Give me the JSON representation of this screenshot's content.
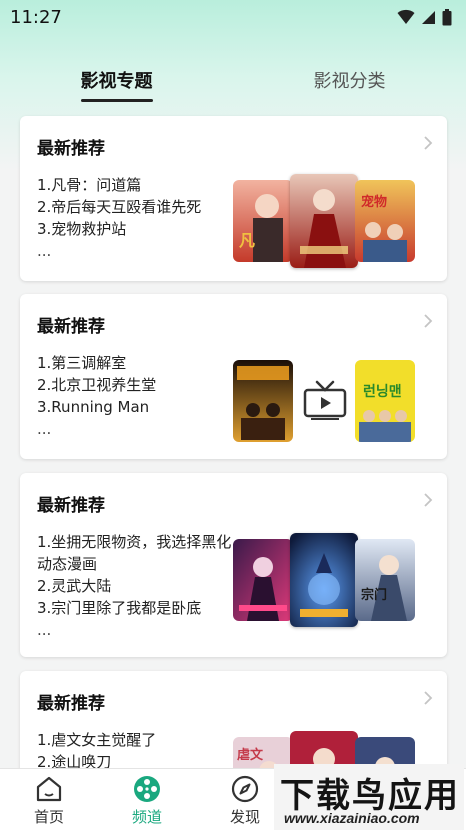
{
  "status_bar": {
    "time": "11:27"
  },
  "tabs": [
    {
      "label": "影视专题",
      "active": true
    },
    {
      "label": "影视分类",
      "active": false
    }
  ],
  "cards": [
    {
      "title": "最新推荐",
      "items": [
        "1.凡骨：问道篇",
        "2.帝后每天互殴看谁先死",
        "3.宠物救护站"
      ],
      "more": "...",
      "posters": [
        {
          "caption": "凡骨",
          "colors": [
            "#c43a2a",
            "#f2b3a0"
          ]
        },
        {
          "caption": "帝后每天互殴看谁先死",
          "colors": [
            "#9a1d16",
            "#e8c7b8"
          ]
        },
        {
          "caption": "宠物救护站",
          "colors": [
            "#c73a2e",
            "#f0c45a"
          ]
        }
      ]
    },
    {
      "title": "最新推荐",
      "items": [
        "1.第三调解室",
        "2.北京卫视养生堂",
        "3.Running Man"
      ],
      "more": "...",
      "posters": [
        {
          "caption": "第三调解室",
          "colors": [
            "#2a1a10",
            "#e0a030"
          ]
        },
        {
          "caption": "",
          "colors": [
            "#ffffff",
            "#ffffff"
          ]
        },
        {
          "caption": "런닝맨",
          "colors": [
            "#f2de2a",
            "#3a8a3a"
          ]
        }
      ]
    },
    {
      "title": "最新推荐",
      "items": [
        "1.坐拥无限物资，我选择黑化 动态漫画",
        "2.灵武大陆",
        "3.宗门里除了我都是卧底"
      ],
      "more": "...",
      "posters": [
        {
          "caption": "坐拥无限物资",
          "colors": [
            "#3a1a4a",
            "#e03a7a"
          ]
        },
        {
          "caption": "灵武大陆",
          "colors": [
            "#0e1a3a",
            "#2a6ad0"
          ]
        },
        {
          "caption": "宗门里除了我都是卧底",
          "colors": [
            "#c8d6e8",
            "#5a6a8a"
          ]
        }
      ]
    },
    {
      "title": "最新推荐",
      "items": [
        "1.虐文女主觉醒了",
        "2.途山唤刀"
      ],
      "more": "",
      "posters": [
        {
          "caption": "虐文女主觉醒了",
          "colors": [
            "#e8d0d8",
            "#c43a4a"
          ]
        },
        {
          "caption": "",
          "colors": [
            "#b0203a",
            "#e06a6a"
          ]
        },
        {
          "caption": "",
          "colors": [
            "#3a4a7a",
            "#d8c0a0"
          ]
        }
      ]
    }
  ],
  "bottom_nav": [
    {
      "label": "首页",
      "icon": "home-icon",
      "active": false
    },
    {
      "label": "频道",
      "icon": "film-reel-icon",
      "active": true
    },
    {
      "label": "发现",
      "icon": "compass-icon",
      "active": false
    },
    {
      "label": "",
      "icon": "user-icon",
      "active": false
    }
  ],
  "watermark": {
    "title": "下载鸟应用",
    "url": "www.xiazainiao.com"
  },
  "colors": {
    "accent": "#1aa87f",
    "header_mint": "#b9eedc"
  }
}
